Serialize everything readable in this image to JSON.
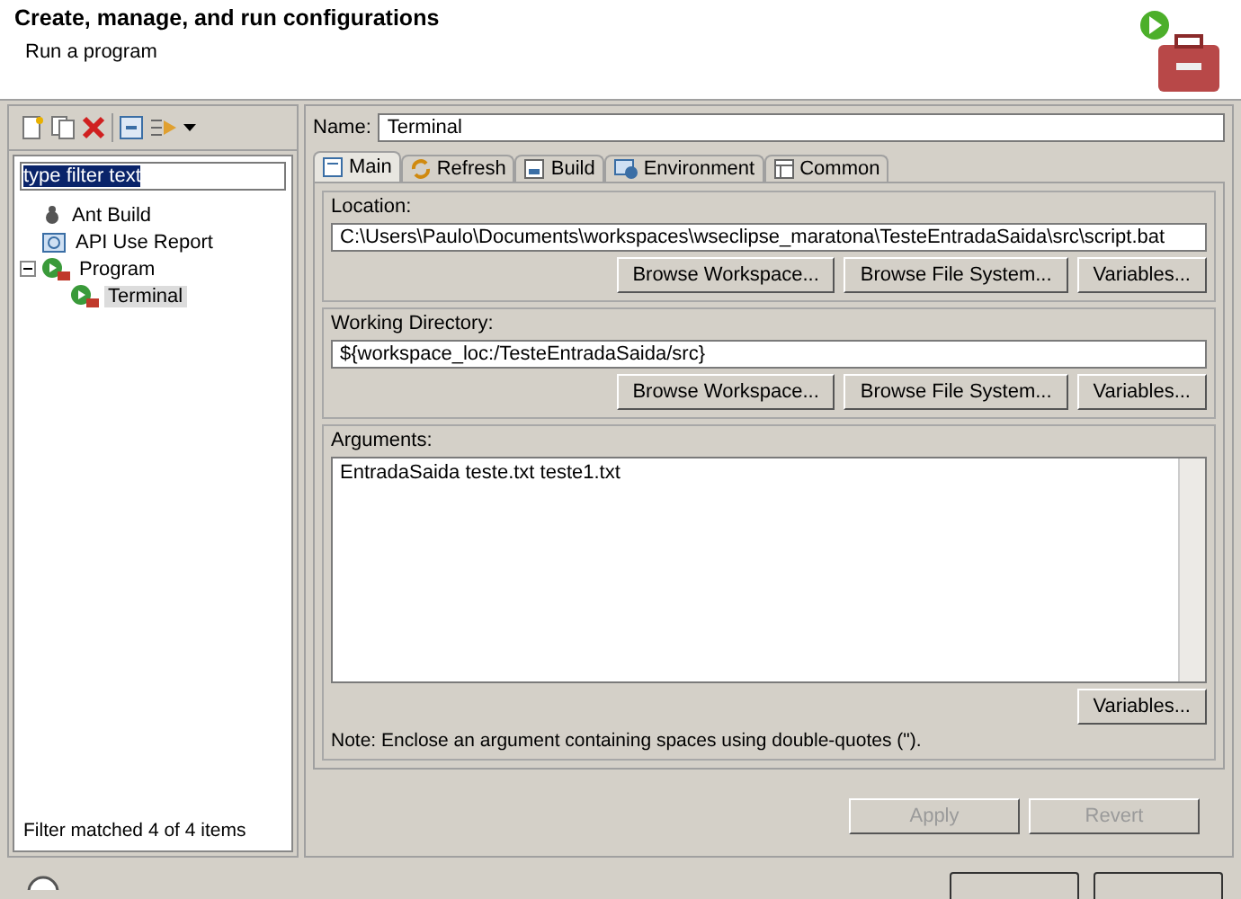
{
  "header": {
    "title": "Create, manage, and run configurations",
    "subtitle": "Run a program"
  },
  "sidebar": {
    "filter": {
      "value": "type filter text",
      "selected": true
    },
    "tree": [
      {
        "label": "Ant Build",
        "kind": "ant",
        "selected": false
      },
      {
        "label": "API Use Report",
        "kind": "api",
        "selected": false
      },
      {
        "label": "Program",
        "kind": "program",
        "expanded": true,
        "selected": false,
        "children": [
          {
            "label": "Terminal",
            "kind": "program",
            "selected": true
          }
        ]
      }
    ],
    "status": "Filter matched 4 of 4 items"
  },
  "name": {
    "label": "Name:",
    "value": "Terminal"
  },
  "tabs": [
    {
      "label": "Main",
      "kind": "main",
      "selected": true
    },
    {
      "label": "Refresh",
      "kind": "refresh",
      "selected": false
    },
    {
      "label": "Build",
      "kind": "build",
      "selected": false
    },
    {
      "label": "Environment",
      "kind": "env",
      "selected": false
    },
    {
      "label": "Common",
      "kind": "common",
      "selected": false
    }
  ],
  "sections": [
    {
      "label": "Location:",
      "kind": "field",
      "value": "C:\\Users\\Paulo\\Documents\\workspaces\\wseclipse_maratona\\TesteEntradaSaida\\src\\script.bat",
      "buttons": [
        "Browse Workspace...",
        "Browse File System...",
        "Variables..."
      ]
    },
    {
      "label": "Working Directory:",
      "kind": "field",
      "value": "${workspace_loc:/TesteEntradaSaida/src}",
      "buttons": [
        "Browse Workspace...",
        "Browse File System...",
        "Variables..."
      ]
    },
    {
      "label": "Arguments:",
      "kind": "area",
      "value": "EntradaSaida teste.txt teste1.txt",
      "buttons": [
        "Variables..."
      ],
      "note": "Note: Enclose an argument containing spaces using double-quotes (\")."
    }
  ],
  "actions": [
    {
      "label": "Apply",
      "disabled": true
    },
    {
      "label": "Revert",
      "disabled": true
    }
  ]
}
